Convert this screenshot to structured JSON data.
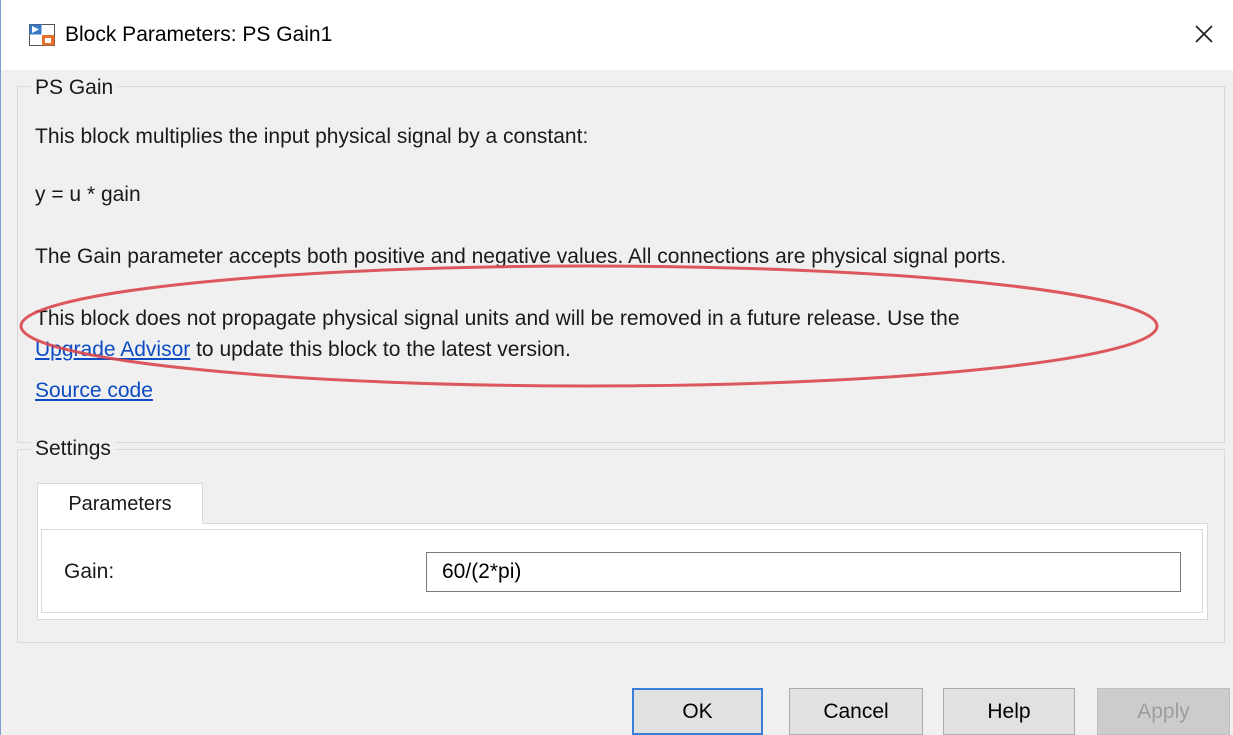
{
  "window": {
    "title": "Block Parameters: PS Gain1",
    "close_symbol": "✕",
    "app_icon": "simulink-block-icon",
    "close_icon": "close-icon"
  },
  "description_group": {
    "legend": "PS Gain",
    "line1": "This block multiplies the input physical signal by a constant:",
    "equation": "y = u * gain",
    "line3": "The Gain parameter accepts both positive and negative values. All connections are physical signal ports.",
    "warning_part1": "This block does not propagate physical signal units and will be removed in a future release. Use the",
    "upgrade_link": "Upgrade Advisor",
    "warning_part2": " to update this block to the latest version.",
    "source_link": "Source code",
    "highlight_color": "#d9474c"
  },
  "settings_group": {
    "legend": "Settings",
    "tabs": [
      {
        "label": "Parameters",
        "selected": true
      }
    ],
    "fields": [
      {
        "label": "Gain:",
        "value": "60/(2*pi)"
      }
    ]
  },
  "buttons": {
    "ok": "OK",
    "cancel": "Cancel",
    "help": "Help",
    "apply": "Apply",
    "apply_enabled": false,
    "focus_color": "#3c7fd8"
  }
}
